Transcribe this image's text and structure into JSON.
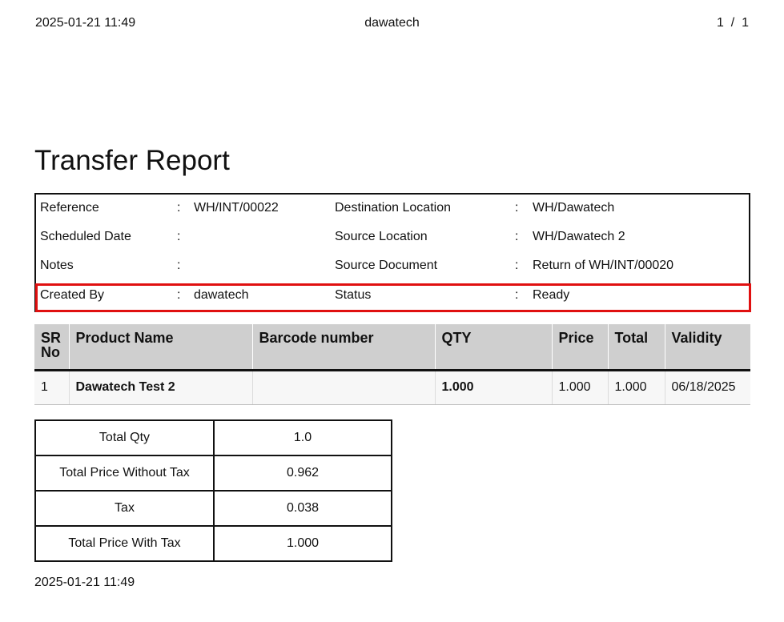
{
  "page_header": {
    "datetime": "2025-01-21 11:49",
    "company": "dawatech",
    "page_number": "1",
    "page_sep": "/",
    "page_total": "1"
  },
  "title": "Transfer Report",
  "info": {
    "colon": ":",
    "rows": [
      {
        "label1": "Reference",
        "value1": "WH/INT/00022",
        "label2": "Destination Location",
        "value2": "WH/Dawatech"
      },
      {
        "label1": "Scheduled Date",
        "value1": "",
        "label2": "Source Location",
        "value2": "WH/Dawatech 2"
      },
      {
        "label1": "Notes",
        "value1": "",
        "label2": "Source Document",
        "value2": "Return of WH/INT/00020"
      },
      {
        "label1": "Created By",
        "value1": "dawatech",
        "label2": "Status",
        "value2": "Ready"
      }
    ]
  },
  "products": {
    "headers": {
      "sr_line1": "SR",
      "sr_line2": "No",
      "product_name": "Product Name",
      "barcode": "Barcode number",
      "qty": "QTY",
      "price": "Price",
      "total": "Total",
      "validity": "Validity"
    },
    "rows": [
      {
        "sr": "1",
        "product_name": "Dawatech Test 2",
        "barcode": "",
        "qty": "1.000",
        "price": "1.000",
        "total": "1.000",
        "validity": "06/18/2025"
      }
    ]
  },
  "totals": [
    {
      "label": "Total Qty",
      "value": "1.0"
    },
    {
      "label": "Total Price Without Tax",
      "value": "0.962"
    },
    {
      "label": "Tax",
      "value": "0.038"
    },
    {
      "label": "Total Price With Tax",
      "value": "1.000"
    }
  ],
  "footer": {
    "datetime": "2025-01-21 11:49"
  },
  "colors": {
    "highlight_border": "#e01010",
    "table_header_bg": "#cfcfcf",
    "row_bg": "#f7f7f7"
  }
}
